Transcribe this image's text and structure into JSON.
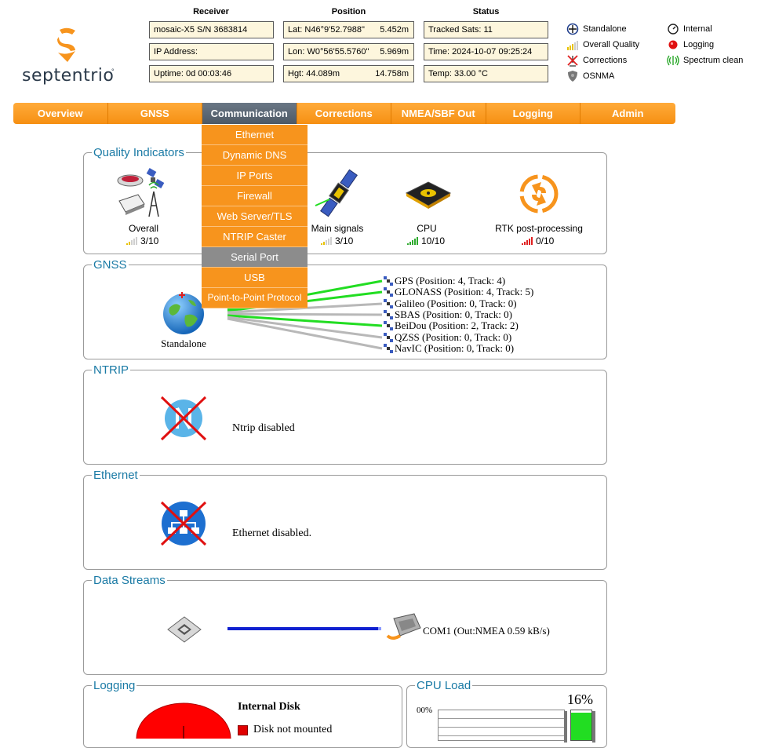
{
  "logo": {
    "text": "septentrio"
  },
  "header": {
    "receiver_title": "Receiver",
    "position_title": "Position",
    "status_title": "Status",
    "receiver": [
      "mosaic-X5 S/N 3683814",
      "IP Address:",
      "Uptime: 0d 00:03:46"
    ],
    "position": [
      {
        "label": "Lat:  N46°9'52.7988\"",
        "acc": "5.452m"
      },
      {
        "label": "Lon:  W0°56'55.5760\"",
        "acc": "5.969m"
      },
      {
        "label": "Hgt:  44.089m",
        "acc": "14.758m"
      }
    ],
    "status": [
      "Tracked Sats: 11",
      "Time: 2024-10-07 09:25:24",
      "Temp: 33.00 °C"
    ]
  },
  "legend": {
    "standalone": "Standalone",
    "overall_quality": "Overall Quality",
    "corrections": "Corrections",
    "osnma": "OSNMA",
    "internal": "Internal",
    "logging": "Logging",
    "spectrum_clean": "Spectrum clean"
  },
  "nav": {
    "tabs": [
      "Overview",
      "GNSS",
      "Communication",
      "Corrections",
      "NMEA/SBF Out",
      "Logging",
      "Admin"
    ],
    "active": "Communication"
  },
  "dropdown": {
    "items": [
      "Ethernet",
      "Dynamic DNS",
      "IP Ports",
      "Firewall",
      "Web Server/TLS",
      "NTRIP Caster",
      "Serial Port",
      "USB",
      "Point-to-Point Protocol"
    ],
    "highlighted": "Serial Port"
  },
  "quality": {
    "title": "Quality Indicators",
    "items": [
      {
        "label": "Overall",
        "score": "3/10",
        "level": 3,
        "color": "#e8c200"
      },
      {
        "label": "Main signals",
        "score": "3/10",
        "level": 3,
        "color": "#e8c200"
      },
      {
        "label": "CPU",
        "score": "10/10",
        "level": 10,
        "color": "#2eaa2e"
      },
      {
        "label": "RTK post-processing",
        "score": "0/10",
        "level": 0,
        "color": "#e02020"
      }
    ]
  },
  "gnss": {
    "title": "GNSS",
    "mode_label": "Standalone",
    "constellations": [
      "GPS (Position: 4, Track: 4)",
      "GLONASS (Position: 4, Track: 5)",
      "Galileo (Position: 0, Track: 0)",
      "SBAS (Position: 0, Track: 0)",
      "BeiDou (Position: 2, Track: 2)",
      "QZSS (Position: 0, Track: 0)",
      "NavIC (Position: 0, Track: 0)"
    ],
    "active_color": "#22dd22",
    "inactive_color": "#b8b8b8"
  },
  "ntrip": {
    "title": "NTRIP",
    "message": "Ntrip disabled"
  },
  "ethernet": {
    "title": "Ethernet",
    "message": "Ethernet disabled."
  },
  "streams": {
    "title": "Data Streams",
    "port_label": "COM1 (Out:NMEA 0.59 kB/s)"
  },
  "logging": {
    "title": "Logging",
    "disk_title": "Internal Disk",
    "disk_status": "Disk not mounted"
  },
  "cpu": {
    "title": "CPU Load",
    "percent": "16%",
    "axis_top": "00%",
    "load": 0.16
  }
}
